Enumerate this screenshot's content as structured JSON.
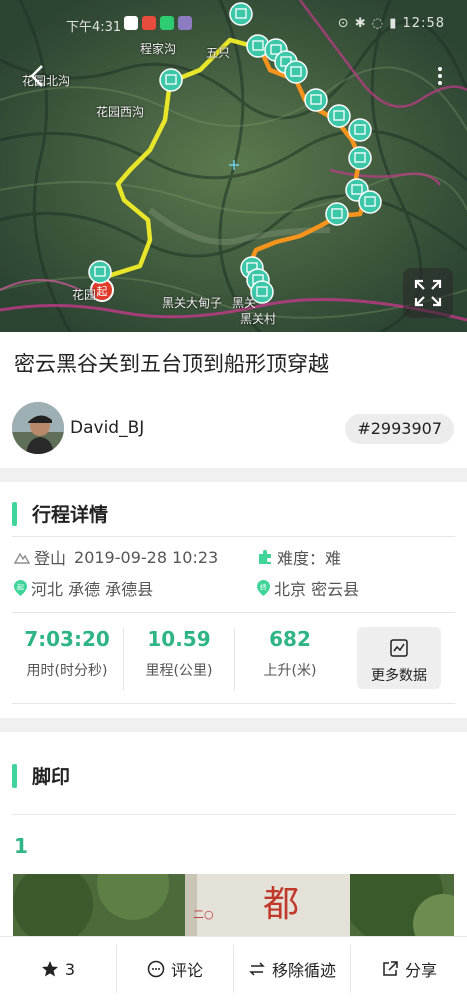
{
  "status_bar": {
    "time": "下午4:31",
    "system": "⊙ ✱ ◌ ▮ 12:58"
  },
  "map": {
    "labels": {
      "chengjiagou": "程家沟",
      "huayuanbeigou": "花园北沟",
      "huayuanxigou": "花园西沟",
      "huayuan": "花园",
      "heiguandianzi": "黑关大甸子",
      "heiguan": "黑关",
      "heiguancun": "黑关村",
      "wuzhi": "五只"
    },
    "start_marker": "起",
    "colors": {
      "route_yellow": "#e8e62a",
      "route_orange": "#f7941d",
      "photo_pin": "#3cc7a8",
      "boundary": "#c23a8a"
    }
  },
  "trip": {
    "title": "密云黑谷关到五台顶到船形顶穿越",
    "author": "David_BJ",
    "id": "#2993907"
  },
  "details": {
    "heading": "行程详情",
    "activity": "登山",
    "datetime": "2019-09-28 10:23",
    "difficulty_label": "难度：",
    "difficulty": "难",
    "start_place": "河北 承德 承德县",
    "end_place": "北京 密云县",
    "stats": [
      {
        "value": "7:03:20",
        "label": "用时(时分秒)"
      },
      {
        "value": "10.59",
        "label": "里程(公里)"
      },
      {
        "value": "682",
        "label": "上升(米)"
      }
    ],
    "more_data": "更多数据"
  },
  "footprints": {
    "heading": "脚印",
    "first_index": "1",
    "photo_text": "都"
  },
  "bottom_bar": {
    "likes": "3",
    "comment": "评论",
    "remove_follow": "移除循迹",
    "share": "分享"
  },
  "accent_color": "#3fd49a"
}
